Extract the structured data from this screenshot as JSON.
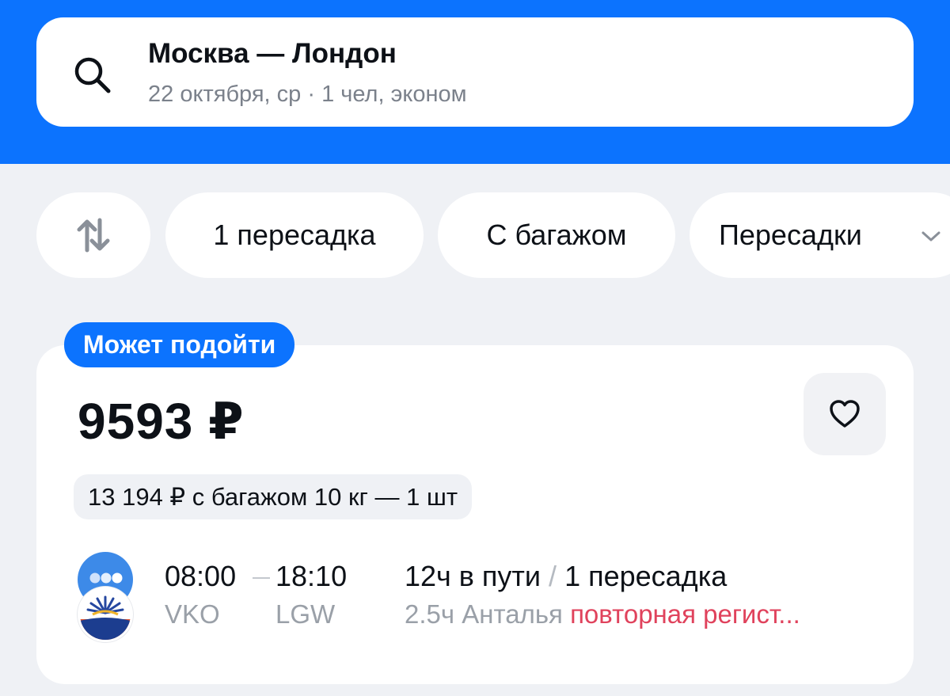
{
  "search": {
    "route": "Москва — Лондон",
    "details": "22 октября, ср · 1 чел, эконом"
  },
  "filters": {
    "sort_icon": "sort-arrows-icon",
    "chips": [
      "1 пересадка",
      "С багажом",
      "Пересадки"
    ]
  },
  "result": {
    "badge": "Может подойти",
    "price": "9593 ₽",
    "baggage_offer": "13 194 ₽ с багажом 10 кг — 1 шт",
    "departure_time": "08:00",
    "arrival_time": "18:10",
    "departure_airport": "VKO",
    "arrival_airport": "LGW",
    "duration": "12ч в пути",
    "separator": "/",
    "stops": "1 пересадка",
    "layover": "2.5ч Анталья",
    "layover_warning": "повторная регист..."
  },
  "colors": {
    "brand_blue": "#0c73fe",
    "warning_red": "#e0425c",
    "background": "#eff1f5"
  }
}
